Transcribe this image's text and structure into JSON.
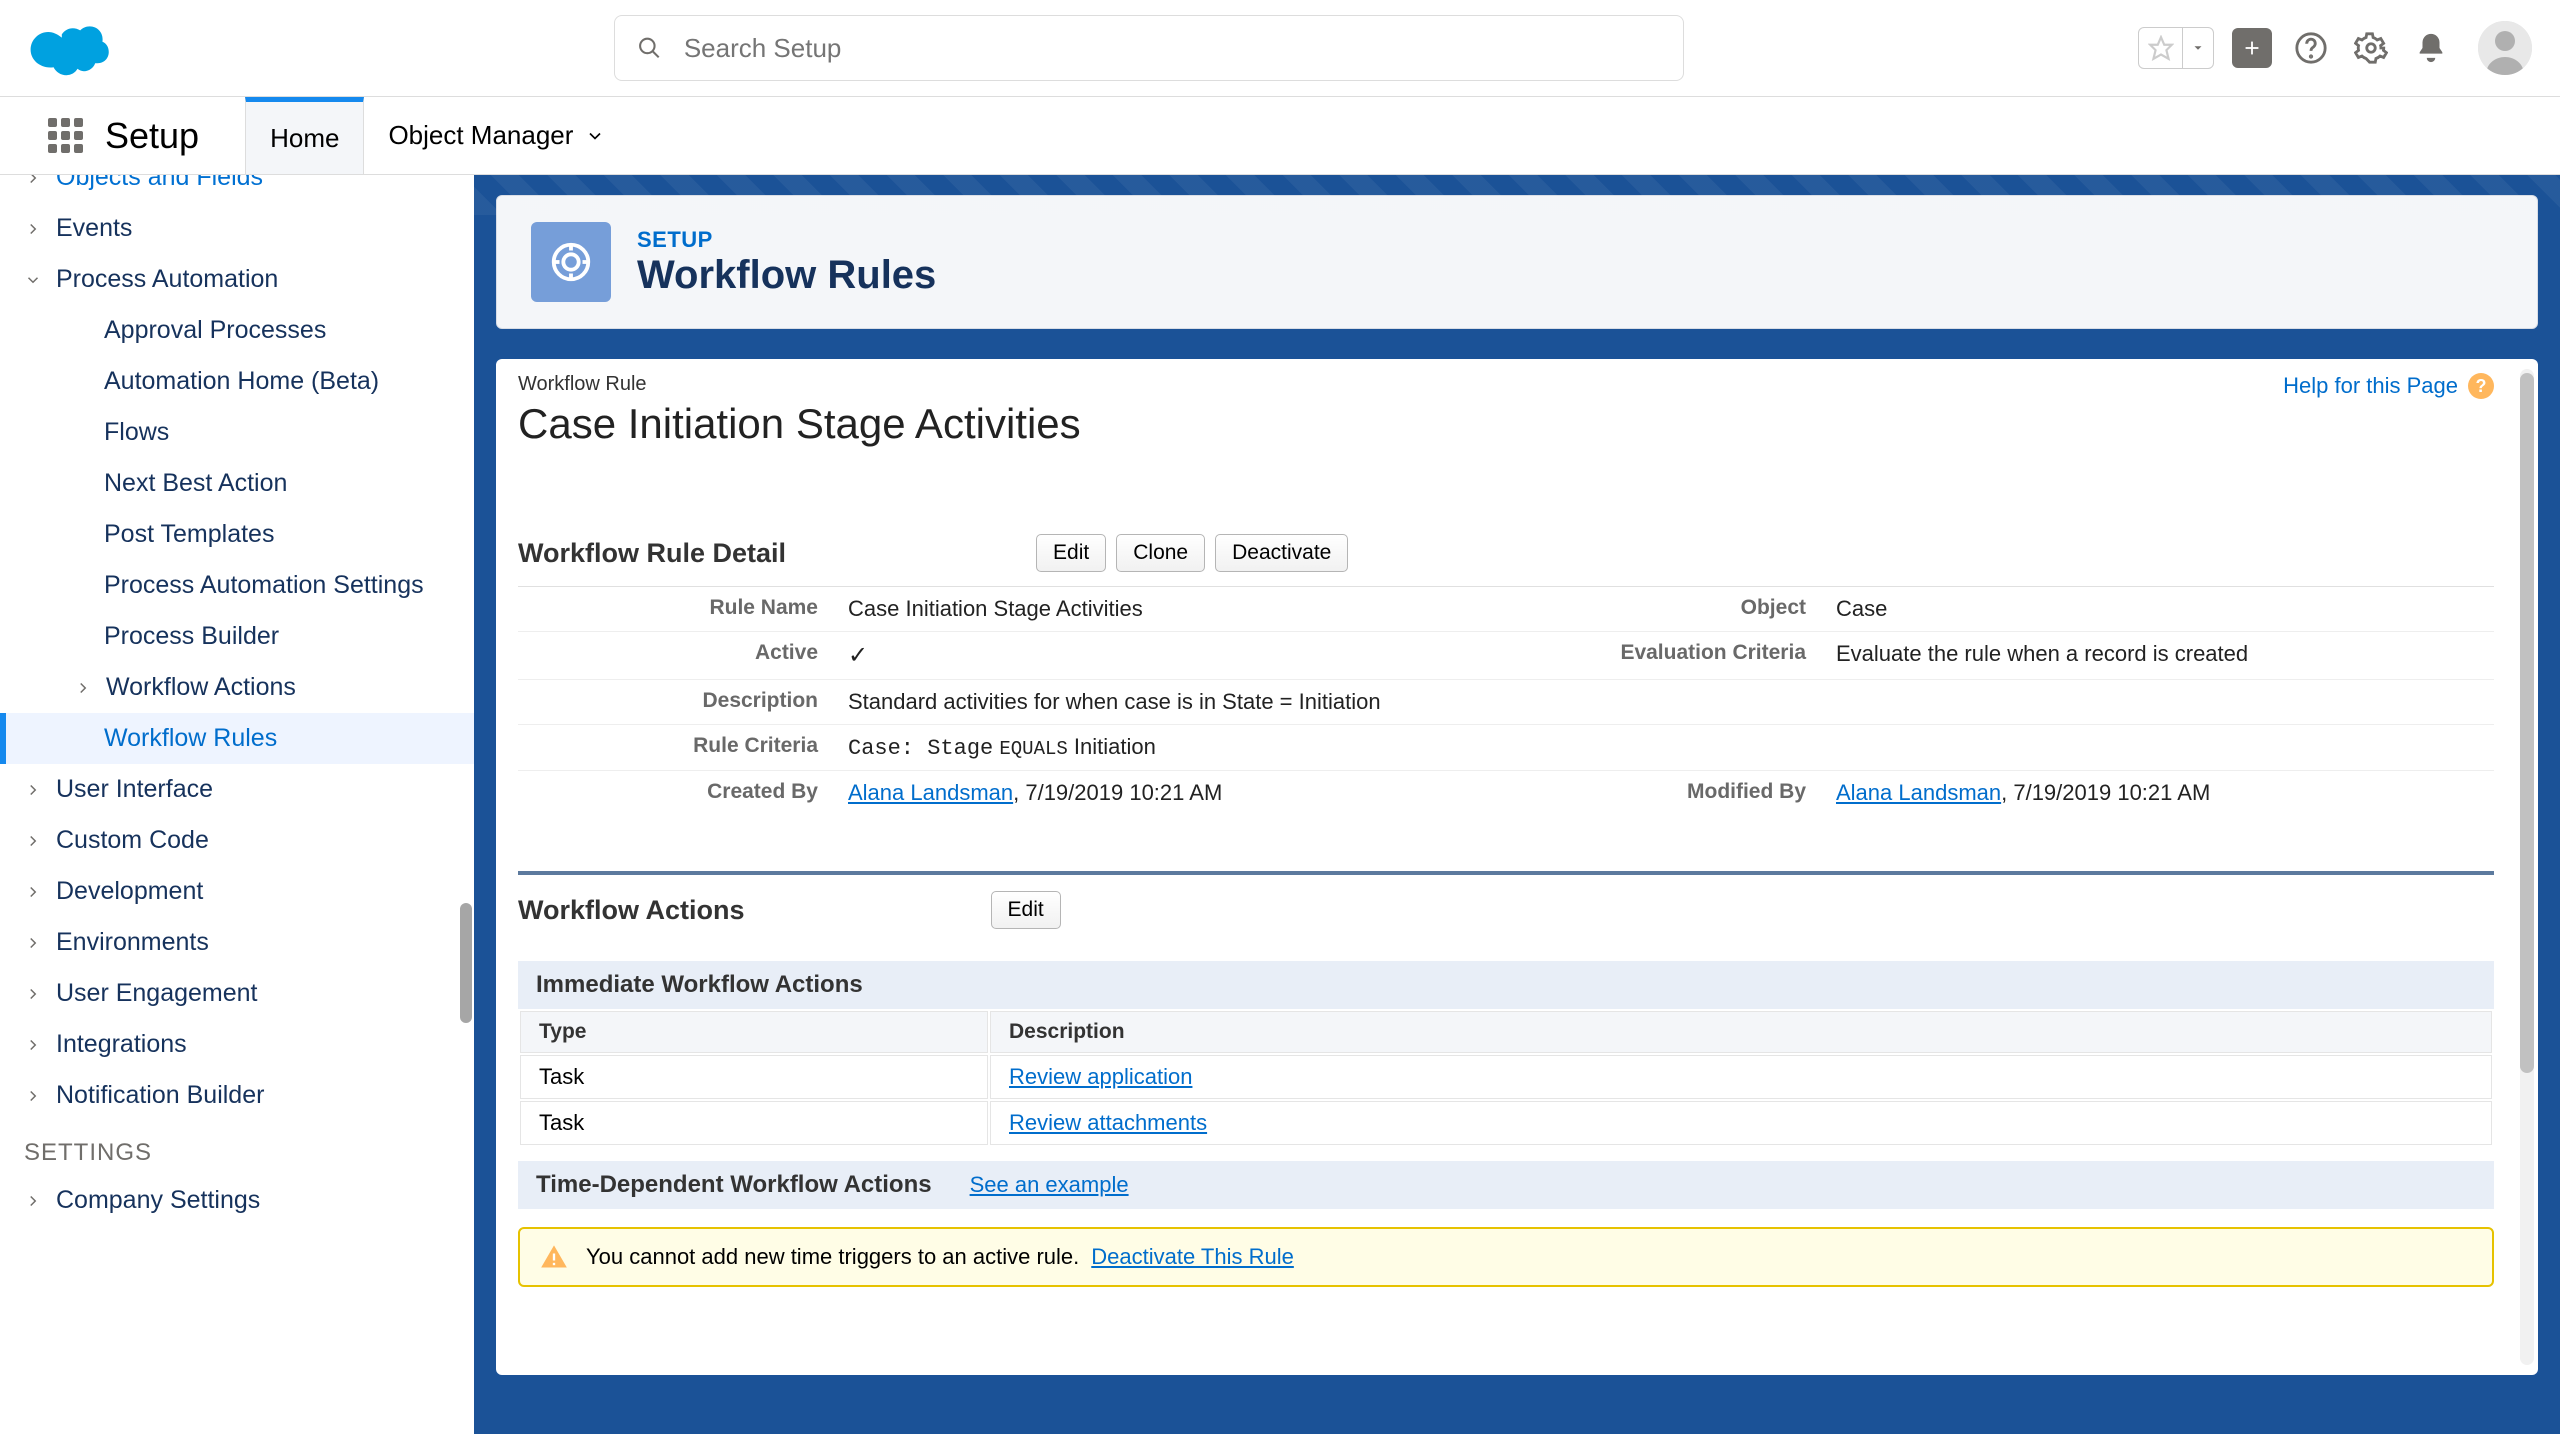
{
  "header": {
    "search_placeholder": "Search Setup"
  },
  "nav": {
    "app_name": "Setup",
    "tabs": {
      "home": "Home",
      "object_manager": "Object Manager"
    }
  },
  "sidebar": {
    "objects_fields": "Objects and Fields",
    "events": "Events",
    "process_automation": "Process Automation",
    "pa_children": {
      "approval": "Approval Processes",
      "automation_home": "Automation Home (Beta)",
      "flows": "Flows",
      "next_best_action": "Next Best Action",
      "post_templates": "Post Templates",
      "pa_settings": "Process Automation Settings",
      "process_builder": "Process Builder",
      "workflow_actions": "Workflow Actions",
      "workflow_rules": "Workflow Rules"
    },
    "user_interface": "User Interface",
    "custom_code": "Custom Code",
    "development": "Development",
    "environments": "Environments",
    "user_engagement": "User Engagement",
    "integrations": "Integrations",
    "notification_builder": "Notification Builder",
    "settings_heading": "SETTINGS",
    "company_settings": "Company Settings"
  },
  "page": {
    "crumb": "SETUP",
    "title": "Workflow Rules",
    "help_link": "Help for this Page"
  },
  "record": {
    "type_label": "Workflow Rule",
    "name": "Case Initiation Stage Activities",
    "detail_heading": "Workflow Rule Detail",
    "buttons": {
      "edit": "Edit",
      "clone": "Clone",
      "deactivate": "Deactivate"
    },
    "labels": {
      "rule_name": "Rule Name",
      "object": "Object",
      "active": "Active",
      "evaluation_criteria": "Evaluation Criteria",
      "description": "Description",
      "rule_criteria": "Rule Criteria",
      "created_by": "Created By",
      "modified_by": "Modified By"
    },
    "values": {
      "rule_name": "Case Initiation Stage Activities",
      "object": "Case",
      "evaluation_criteria": "Evaluate the rule when a record is created",
      "description": "Standard activities for when case is in State = Initiation",
      "rule_criteria_field": "Case: Stage",
      "rule_criteria_op": "EQUALS",
      "rule_criteria_value": "Initiation",
      "created_by_name": "Alana Landsman",
      "created_by_date": ", 7/19/2019 10:21 AM",
      "modified_by_name": "Alana Landsman",
      "modified_by_date": ", 7/19/2019 10:21 AM"
    }
  },
  "actions": {
    "heading": "Workflow Actions",
    "edit": "Edit",
    "immediate_heading": "Immediate Workflow Actions",
    "columns": {
      "type": "Type",
      "description": "Description"
    },
    "immediate": [
      {
        "type": "Task",
        "desc": "Review application"
      },
      {
        "type": "Task",
        "desc": "Review attachments"
      }
    ],
    "time_heading": "Time-Dependent Workflow Actions",
    "see_example": "See an example",
    "warn_text": "You cannot add new time triggers to an active rule.",
    "deactivate_link": "Deactivate This Rule"
  }
}
